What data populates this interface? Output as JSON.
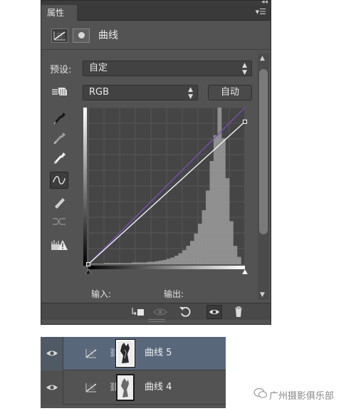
{
  "properties_panel": {
    "tab_title": "属性",
    "header_title": "曲线",
    "preset_label": "预设:",
    "preset_value": "自定",
    "channel_value": "RGB",
    "auto_label": "自动",
    "input_label": "输入:",
    "output_label": "输出:"
  },
  "curve_chart": {
    "type": "line",
    "xlim": [
      0,
      255
    ],
    "ylim": [
      0,
      255
    ],
    "grid": true,
    "series": [
      {
        "color": "#ffffff",
        "points": [
          [
            0,
            0
          ],
          [
            255,
            232
          ]
        ]
      },
      {
        "color": "#7050c0",
        "points": [
          [
            0,
            0
          ],
          [
            255,
            255
          ]
        ]
      },
      {
        "color": "#c04040",
        "points": [
          [
            0,
            0
          ],
          [
            255,
            255
          ]
        ]
      }
    ],
    "histogram": [
      1,
      1,
      1,
      1,
      2,
      2,
      2,
      2,
      2,
      2,
      2,
      3,
      3,
      3,
      3,
      4,
      4,
      5,
      6,
      7,
      9,
      11,
      14,
      18,
      23,
      30,
      38,
      50,
      66,
      88,
      120,
      168,
      210,
      255,
      205,
      140,
      70,
      30,
      12,
      0
    ]
  },
  "layers": [
    {
      "name": "曲线 5",
      "selected": true
    },
    {
      "name": "曲线 4",
      "selected": false
    }
  ],
  "watermark": "广州摄影俱乐部",
  "colors": {
    "panel_bg": "#535353",
    "selected_layer": "#58677a",
    "curve_white": "#ffffff",
    "curve_blue": "#7050c0",
    "curve_red": "#c04040"
  }
}
